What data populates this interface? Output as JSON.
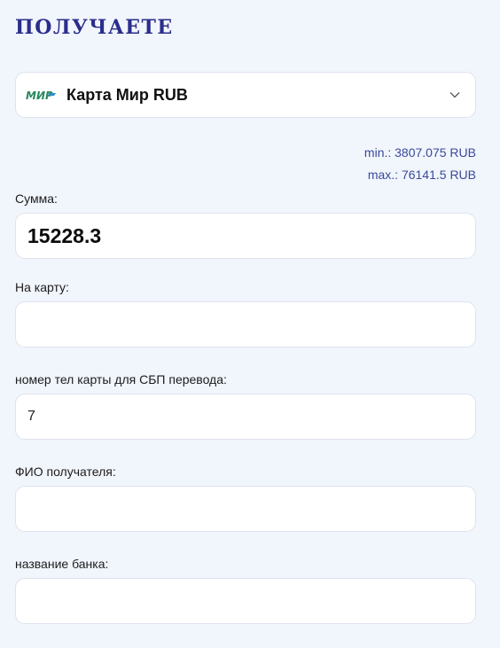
{
  "heading": "ПОЛУЧАЕТЕ",
  "currency_select": {
    "icon": "mir-logo",
    "logo_text": "МИР",
    "selected": "Карта Мир RUB"
  },
  "limits": {
    "min": "min.: 3807.075 RUB",
    "max": "max.: 76141.5 RUB"
  },
  "fields": {
    "amount": {
      "label": "Сумма:",
      "value": "15228.3"
    },
    "card": {
      "label": "На карту:",
      "value": ""
    },
    "phone": {
      "label": "номер тел карты для СБП перевода:",
      "value": "7"
    },
    "recipient": {
      "label": "ФИО получателя:",
      "value": ""
    },
    "bank": {
      "label": "название банка:",
      "value": ""
    }
  },
  "colors": {
    "heading": "#2b2d8c",
    "limits": "#3a4a9a",
    "mir_green": "#27885e",
    "background": "#f1f5fc"
  }
}
